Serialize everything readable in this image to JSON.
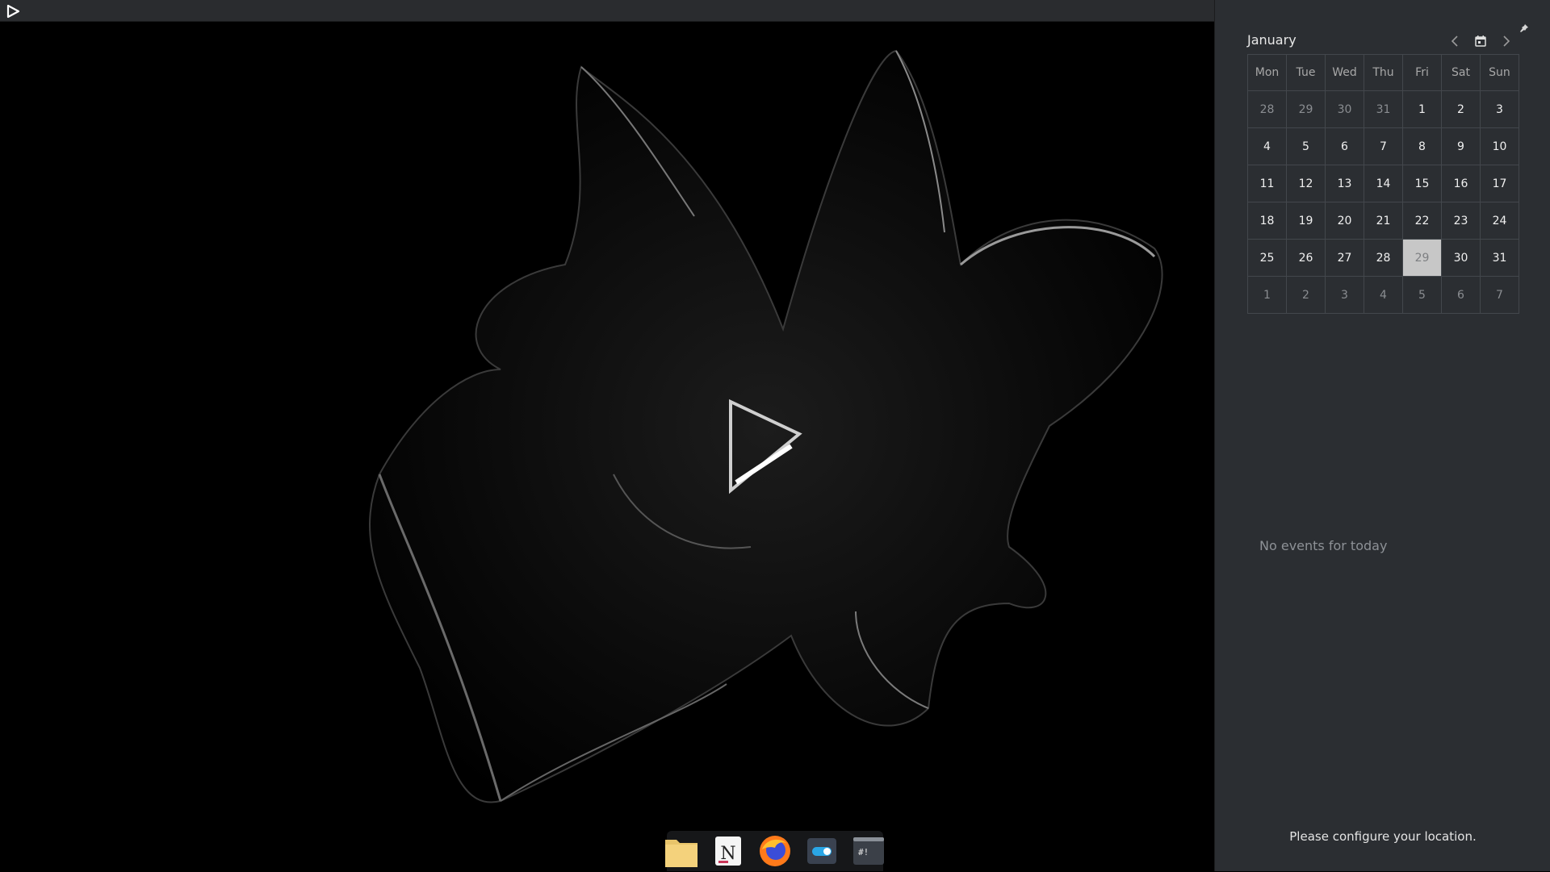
{
  "topbar": {
    "launcher_icon": "play-triangle-icon"
  },
  "dock": {
    "items": [
      {
        "name": "files",
        "icon": "folder-icon"
      },
      {
        "name": "notes",
        "icon": "notes-app-icon"
      },
      {
        "name": "firefox",
        "icon": "firefox-icon"
      },
      {
        "name": "settings",
        "icon": "toggle-icon"
      },
      {
        "name": "terminal",
        "icon": "terminal-icon"
      }
    ]
  },
  "calendar": {
    "month": "January",
    "weekdays": [
      "Mon",
      "Tue",
      "Wed",
      "Thu",
      "Fri",
      "Sat",
      "Sun"
    ],
    "weeks": [
      [
        "28",
        "29",
        "30",
        "31",
        "1",
        "2",
        "3"
      ],
      [
        "4",
        "5",
        "6",
        "7",
        "8",
        "9",
        "10"
      ],
      [
        "11",
        "12",
        "13",
        "14",
        "15",
        "16",
        "17"
      ],
      [
        "18",
        "19",
        "20",
        "21",
        "22",
        "23",
        "24"
      ],
      [
        "25",
        "26",
        "27",
        "28",
        "29",
        "30",
        "31"
      ],
      [
        "1",
        "2",
        "3",
        "4",
        "5",
        "6",
        "7"
      ]
    ],
    "today": "29",
    "icons": {
      "prev": "chevron-left-icon",
      "today": "calendar-icon",
      "next": "chevron-right-icon",
      "pin": "pin-icon"
    }
  },
  "events": {
    "empty_message": "No events for today"
  },
  "weather": {
    "message": "Please configure your location."
  }
}
